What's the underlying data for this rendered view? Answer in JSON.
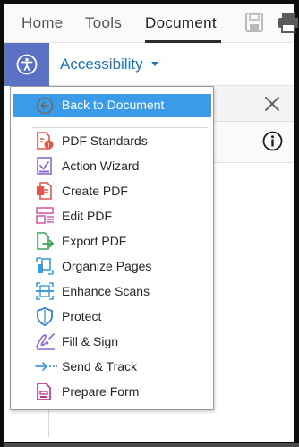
{
  "tabs": {
    "home": "Home",
    "tools": "Tools",
    "document": "Document"
  },
  "header": {
    "title": "Accessibility"
  },
  "menu": {
    "back_label": "Back to Document",
    "items": [
      {
        "label": "PDF Standards",
        "icon": "pdf-standards-icon"
      },
      {
        "label": "Action Wizard",
        "icon": "action-wizard-icon"
      },
      {
        "label": "Create PDF",
        "icon": "create-pdf-icon"
      },
      {
        "label": "Edit PDF",
        "icon": "edit-pdf-icon"
      },
      {
        "label": "Export PDF",
        "icon": "export-pdf-icon"
      },
      {
        "label": "Organize Pages",
        "icon": "organize-pages-icon"
      },
      {
        "label": "Enhance Scans",
        "icon": "enhance-scans-icon"
      },
      {
        "label": "Protect",
        "icon": "protect-icon"
      },
      {
        "label": "Fill & Sign",
        "icon": "fill-sign-icon"
      },
      {
        "label": "Send & Track",
        "icon": "send-track-icon"
      },
      {
        "label": "Prepare Form",
        "icon": "prepare-form-icon"
      }
    ]
  },
  "colors": {
    "accent_blue": "#1f72b8",
    "highlight": "#3a9ce8",
    "rail_accessibility": "#5b72c4"
  }
}
